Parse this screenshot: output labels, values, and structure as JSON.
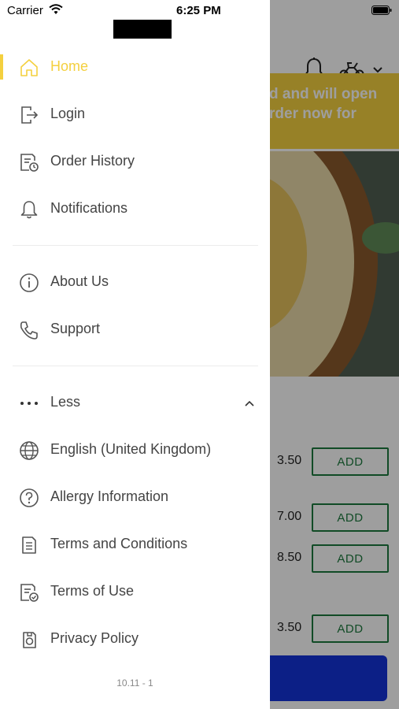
{
  "status_bar": {
    "carrier": "Carrier",
    "time": "6:25 PM"
  },
  "background_app": {
    "banner_text_line1": "d and will open",
    "banner_text_line2": "rder now for",
    "banner_color": "#f4d03f",
    "menu_items": [
      {
        "price": "3.50",
        "button_label": "ADD"
      },
      {
        "price": "7.00",
        "button_label": "ADD"
      },
      {
        "price": "8.50",
        "button_label": "ADD"
      },
      {
        "price": "3.50",
        "button_label": "ADD"
      }
    ],
    "add_button_color": "#1c7a3e",
    "cart_button_color": "#1432d8"
  },
  "drawer": {
    "accent_color": "#f4d03f",
    "items": [
      {
        "label": "Home",
        "icon": "home-icon",
        "active": true
      },
      {
        "label": "Login",
        "icon": "login-icon"
      },
      {
        "label": "Order History",
        "icon": "order-history-icon"
      },
      {
        "label": "Notifications",
        "icon": "bell-icon"
      },
      {
        "label": "About Us",
        "icon": "info-icon"
      },
      {
        "label": "Support",
        "icon": "phone-icon"
      },
      {
        "label": "Less",
        "icon": "more-dots-icon"
      },
      {
        "label": "English (United Kingdom)",
        "icon": "globe-icon"
      },
      {
        "label": "Allergy Information",
        "icon": "question-icon"
      },
      {
        "label": "Terms and Conditions",
        "icon": "document-icon"
      },
      {
        "label": "Terms of Use",
        "icon": "terms-of-use-icon"
      },
      {
        "label": "Privacy Policy",
        "icon": "privacy-icon"
      }
    ],
    "version": "10.11 - 1"
  }
}
